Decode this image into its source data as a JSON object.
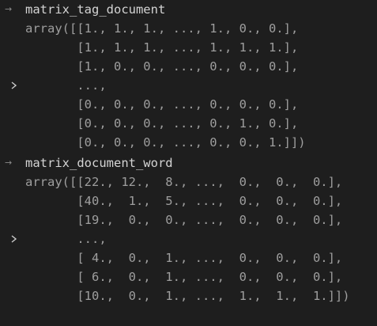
{
  "cells": [
    {
      "prompt_icon": "arrow-right-icon",
      "prompt_glyph": "→",
      "code": "matrix_tag_document",
      "output_toggle_icon": "chevron-right-icon",
      "output_lines": [
        "array([[1., 1., 1., ..., 1., 0., 0.],",
        "       [1., 1., 1., ..., 1., 1., 1.],",
        "       [1., 0., 0., ..., 0., 0., 0.],",
        "       ...,",
        "       [0., 0., 0., ..., 0., 0., 0.],",
        "       [0., 0., 0., ..., 0., 1., 0.],",
        "       [0., 0., 0., ..., 0., 0., 1.]])"
      ]
    },
    {
      "prompt_icon": "arrow-right-icon",
      "prompt_glyph": "→",
      "code": "matrix_document_word",
      "output_toggle_icon": "chevron-right-icon",
      "output_lines": [
        "array([[22., 12.,  8., ...,  0.,  0.,  0.],",
        "       [40.,  1.,  5., ...,  0.,  0.,  0.],",
        "       [19.,  0.,  0., ...,  0.,  0.,  0.],",
        "       ...,",
        "       [ 4.,  0.,  1., ...,  0.,  0.,  0.],",
        "       [ 6.,  0.,  1., ...,  0.,  0.,  0.],",
        "       [10.,  0.,  1., ...,  1.,  1.,  1.]])"
      ]
    }
  ],
  "colors": {
    "background": "#1e1e1e",
    "code_text": "#d4d4d4",
    "output_text": "#9e9e9e",
    "prompt": "#8c8c8c",
    "toggle": "#cccccc"
  }
}
